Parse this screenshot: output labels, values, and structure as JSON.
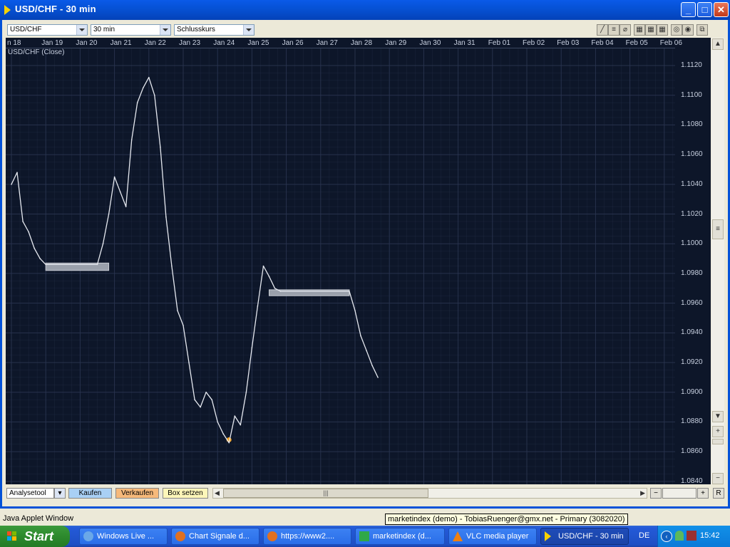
{
  "window": {
    "title": "USD/CHF - 30 min",
    "minimize": "_",
    "maximize": "□",
    "close": "✕"
  },
  "toolbar": {
    "symbol": "USD/CHF",
    "interval": "30 min",
    "price_type": "Schlusskurs"
  },
  "chart": {
    "caption": "USD/CHF (Close)",
    "dates": [
      "n 18",
      "Jan 19",
      "Jan 20",
      "Jan 21",
      "Jan 22",
      "Jan 23",
      "Jan 24",
      "Jan 25",
      "Jan 26",
      "Jan 27",
      "Jan 28",
      "Jan 29",
      "Jan 30",
      "Jan 31",
      "Feb 01",
      "Feb 02",
      "Feb 03",
      "Feb 04",
      "Feb 05",
      "Feb 06"
    ],
    "prices": [
      "1.1120",
      "1.1100",
      "1.1080",
      "1.1060",
      "1.1040",
      "1.1020",
      "1.1000",
      "1.0980",
      "1.0960",
      "1.0940",
      "1.0920",
      "1.0900",
      "1.0880",
      "1.0860",
      "1.0840"
    ]
  },
  "chart_data": {
    "type": "line",
    "title": "USD/CHF (Close)",
    "xlabel": "",
    "ylabel": "",
    "ylim": [
      1.0838,
      1.1132
    ],
    "x_range": [
      "Jan 18",
      "Feb 06"
    ],
    "grid": true,
    "series": [
      {
        "name": "USD/CHF (Close)",
        "color": "#e6e9f0",
        "x": [
          "Jan 18 00:00",
          "Jan 18 04:00",
          "Jan 18 08:00",
          "Jan 18 12:00",
          "Jan 18 16:00",
          "Jan 18 20:00",
          "Jan 19 00:00",
          "Jan 20 12:00",
          "Jan 20 16:00",
          "Jan 20 20:00",
          "Jan 21 00:00",
          "Jan 21 04:00",
          "Jan 21 08:00",
          "Jan 21 12:00",
          "Jan 21 16:00",
          "Jan 21 20:00",
          "Jan 22 00:00",
          "Jan 22 04:00",
          "Jan 22 08:00",
          "Jan 22 12:00",
          "Jan 22 16:00",
          "Jan 22 20:00",
          "Jan 23 00:00",
          "Jan 23 04:00",
          "Jan 23 08:00",
          "Jan 23 12:00",
          "Jan 23 16:00",
          "Jan 23 20:00",
          "Jan 24 00:00",
          "Jan 24 04:00",
          "Jan 24 08:00",
          "Jan 24 12:00",
          "Jan 24 16:00",
          "Jan 24 20:00",
          "Jan 25 00:00",
          "Jan 25 04:00",
          "Jan 25 08:00",
          "Jan 25 12:00",
          "Jan 25 16:00",
          "Jan 25 20:00",
          "Jan 27 20:00",
          "Jan 28 00:00",
          "Jan 28 04:00",
          "Jan 28 08:00",
          "Jan 28 12:00",
          "Jan 28 16:00"
        ],
        "values": [
          1.104,
          1.1048,
          1.1015,
          1.1008,
          1.0997,
          1.099,
          1.0986,
          1.0986,
          1.1,
          1.102,
          1.1045,
          1.1035,
          1.1025,
          1.107,
          1.1095,
          1.1105,
          1.1112,
          1.11,
          1.1065,
          1.1018,
          1.0985,
          1.0955,
          1.0945,
          1.092,
          1.0895,
          1.089,
          1.09,
          1.0895,
          1.088,
          1.0872,
          1.0866,
          1.0884,
          1.0878,
          1.09,
          1.093,
          1.0958,
          1.0985,
          1.0978,
          1.097,
          1.0968,
          1.0968,
          1.0955,
          1.0938,
          1.0928,
          1.0918,
          1.091
        ]
      }
    ],
    "annotations": [
      {
        "type": "box",
        "x_from": "Jan 19",
        "x_to": "Jan 20 20:00",
        "y_from": 1.0982,
        "y_to": 1.0987
      },
      {
        "type": "box",
        "x_from": "Jan 25 12:00",
        "x_to": "Jan 27 20:00",
        "y_from": 1.0965,
        "y_to": 1.0969
      },
      {
        "type": "marker",
        "x": "Jan 24 08:00",
        "y": 1.0868,
        "color": "#f0a020"
      }
    ]
  },
  "bottom": {
    "analysis_tool": "Analysetool",
    "buy": "Kaufen",
    "sell": "Verkaufen",
    "set_box": "Box setzen",
    "minus": "−",
    "plus": "+",
    "reset": "R",
    "grip": "|||"
  },
  "status": {
    "applet": "Java Applet Window",
    "tooltip": "marketindex (demo) - TobiasRuenger@gmx.net - Primary (3082020)"
  },
  "taskbar": {
    "start": "Start",
    "tasks": [
      "Windows Live ...",
      "Chart Signale d...",
      "https://www2....",
      "marketindex (d...",
      "VLC media player",
      "USD/CHF - 30 min"
    ],
    "lang": "DE",
    "clock": "15:42"
  },
  "colors": {
    "chart_bg": "#0d1629",
    "grid": "#2a3550",
    "line": "#e6e9f0",
    "box": "#9aa0ab",
    "title_bar": "#0652d6"
  }
}
